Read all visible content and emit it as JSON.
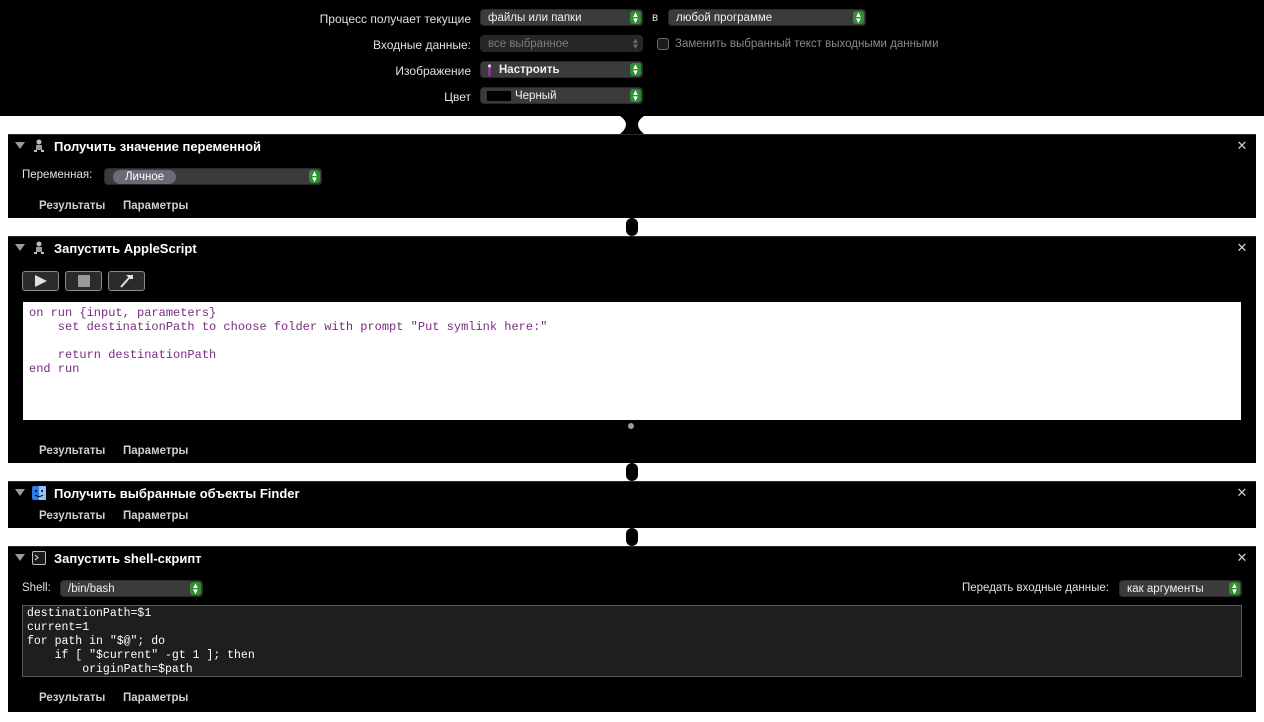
{
  "header": {
    "process_label": "Процесс получает текущие",
    "process_value": "файлы или папки",
    "in_label": "в",
    "app_value": "любой программе",
    "input_label": "Входные данные:",
    "input_value": "все выбранное",
    "replace_label": "Заменить выбранный текст выходными данными",
    "image_label": "Изображение",
    "image_value": "Настроить",
    "color_label": "Цвет",
    "color_value": "Черный",
    "accent": "#2f8f2f"
  },
  "actions": {
    "get_variable": {
      "title": "Получить значение переменной",
      "variable_label": "Переменная:",
      "variable_value": "Личное",
      "results": "Результаты",
      "options": "Параметры"
    },
    "applescript": {
      "title": "Запустить AppleScript",
      "code": "on run {input, parameters}\n    set destinationPath to choose folder with prompt \"Put symlink here:\"\n    \n    return destinationPath\nend run",
      "results": "Результаты",
      "options": "Параметры"
    },
    "finder": {
      "title": "Получить выбранные объекты Finder",
      "results": "Результаты",
      "options": "Параметры"
    },
    "shell": {
      "title": "Запустить shell-скрипт",
      "shell_label": "Shell:",
      "shell_value": "/bin/bash",
      "pass_label": "Передать входные данные:",
      "pass_value": "как аргументы",
      "code": "destinationPath=$1\ncurrent=1\nfor path in \"$@\"; do\n    if [ \"$current\" -gt 1 ]; then\n        originPath=$path",
      "results": "Результаты",
      "options": "Параметры"
    }
  },
  "icons": {
    "disclosure": "disclosure-triangle-icon",
    "automator": "automator-robot-icon",
    "finder": "finder-icon",
    "terminal": "terminal-icon",
    "close": "close-icon",
    "run": "play-icon",
    "stop": "stop-icon",
    "compile": "hammer-icon"
  }
}
